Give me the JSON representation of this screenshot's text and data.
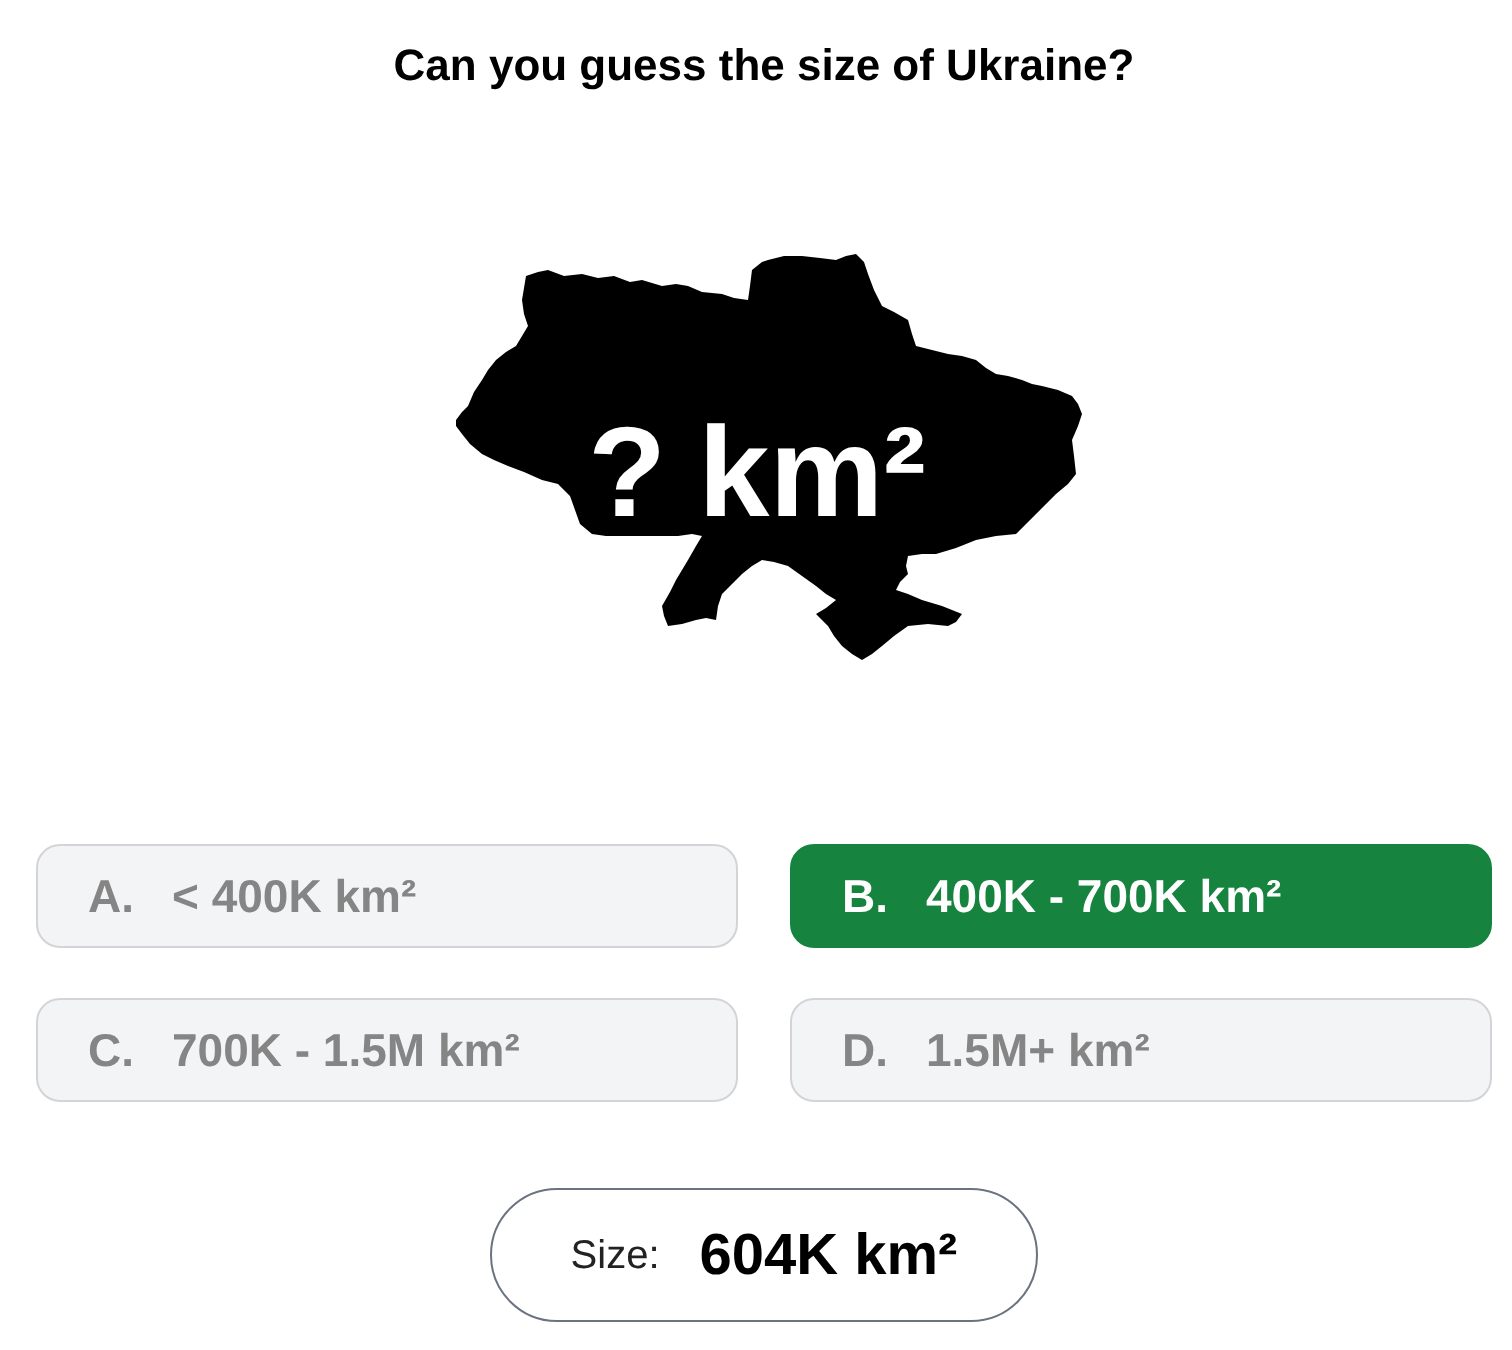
{
  "question": {
    "title": "Can you guess the size of Ukraine?"
  },
  "map": {
    "unknown": "?",
    "unit": "km²"
  },
  "options": [
    {
      "letter": "A.",
      "text": "< 400K km²",
      "selected": false
    },
    {
      "letter": "B.",
      "text": "400K - 700K km²",
      "selected": true
    },
    {
      "letter": "C.",
      "text": "700K - 1.5M km²",
      "selected": false
    },
    {
      "letter": "D.",
      "text": "1.5M+ km²",
      "selected": false
    }
  ],
  "result": {
    "label": "Size:",
    "value": "604K km²"
  }
}
